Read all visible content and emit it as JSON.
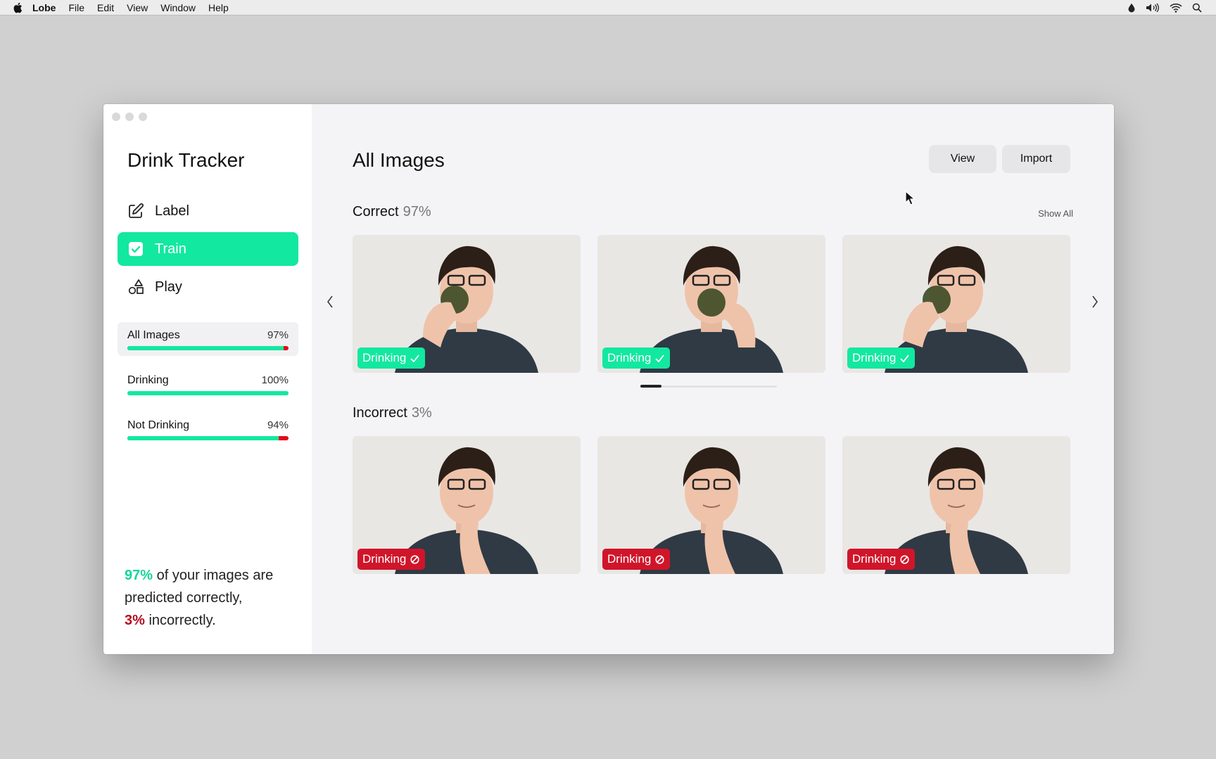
{
  "menubar": {
    "app_name": "Lobe",
    "items": [
      "File",
      "Edit",
      "View",
      "Window",
      "Help"
    ]
  },
  "sidebar": {
    "project_title": "Drink Tracker",
    "nav": [
      {
        "label": "Label",
        "icon": "pencil-icon",
        "active": false
      },
      {
        "label": "Train",
        "icon": "check-square-icon",
        "active": true
      },
      {
        "label": "Play",
        "icon": "shapes-icon",
        "active": false
      }
    ],
    "stats": [
      {
        "label": "All Images",
        "percent": "97%",
        "correct_fraction": 0.97,
        "selected": true
      },
      {
        "label": "Drinking",
        "percent": "100%",
        "correct_fraction": 1.0,
        "selected": false
      },
      {
        "label": "Not Drinking",
        "percent": "94%",
        "correct_fraction": 0.94,
        "selected": false
      }
    ],
    "summary": {
      "correct_pct": "97%",
      "correct_text": " of your images are predicted correctly,",
      "incorrect_pct": "3%",
      "incorrect_text": " incorrectly."
    }
  },
  "main": {
    "title": "All Images",
    "view_button": "View",
    "import_button": "Import",
    "correct_section": {
      "title": "Correct",
      "percent": "97%",
      "show_all": "Show All",
      "images": [
        {
          "label": "Drinking",
          "status": "correct"
        },
        {
          "label": "Drinking",
          "status": "correct"
        },
        {
          "label": "Drinking",
          "status": "correct"
        }
      ]
    },
    "incorrect_section": {
      "title": "Incorrect",
      "percent": "3%",
      "images": [
        {
          "label": "Drinking",
          "status": "incorrect"
        },
        {
          "label": "Drinking",
          "status": "incorrect"
        },
        {
          "label": "Drinking",
          "status": "incorrect"
        }
      ]
    }
  },
  "colors": {
    "accent": "#13e8a0",
    "error": "#d0152a",
    "summary_good": "#13d69a",
    "summary_bad": "#b30d1f"
  }
}
